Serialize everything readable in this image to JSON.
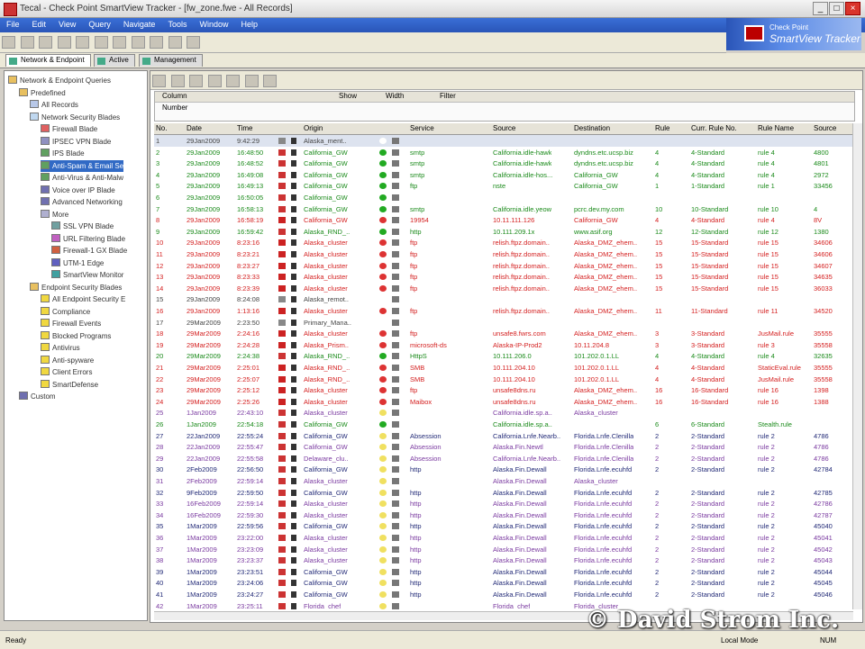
{
  "window": {
    "title": "Tecal - Check Point SmartView Tracker - [fw_zone.fwe - All Records]"
  },
  "menu": [
    "File",
    "Edit",
    "View",
    "Query",
    "Navigate",
    "Tools",
    "Window",
    "Help"
  ],
  "brand": {
    "line1": "Check Point",
    "line2": "SmartView Tracker"
  },
  "tabs": [
    {
      "label": "Network & Endpoint"
    },
    {
      "label": "Active"
    },
    {
      "label": "Management"
    }
  ],
  "tree": [
    {
      "label": "Network & Endpoint Queries",
      "level": 0
    },
    {
      "label": "Predefined",
      "level": 1
    },
    {
      "label": "All Records",
      "level": 2
    },
    {
      "label": "Network Security Blades",
      "level": 2
    },
    {
      "label": "Firewall Blade",
      "level": 3
    },
    {
      "label": "IPSEC VPN Blade",
      "level": 3
    },
    {
      "label": "IPS Blade",
      "level": 3
    },
    {
      "label": "Anti-Spam & Email Se",
      "level": 3,
      "selected": true
    },
    {
      "label": "Anti-Virus & Anti-Malw",
      "level": 3
    },
    {
      "label": "Voice over IP Blade",
      "level": 3
    },
    {
      "label": "Advanced Networking",
      "level": 3
    },
    {
      "label": "More",
      "level": 3
    },
    {
      "label": "SSL VPN Blade",
      "level": 4
    },
    {
      "label": "URL Filtering Blade",
      "level": 4
    },
    {
      "label": "Firewall-1 GX Blade",
      "level": 4
    },
    {
      "label": "UTM-1 Edge",
      "level": 4
    },
    {
      "label": "SmartView Monitor",
      "level": 4
    },
    {
      "label": "Endpoint Security Blades",
      "level": 2
    },
    {
      "label": "All Endpoint Security E",
      "level": 3
    },
    {
      "label": "Compliance",
      "level": 3
    },
    {
      "label": "Firewall Events",
      "level": 3
    },
    {
      "label": "Blocked Programs",
      "level": 3
    },
    {
      "label": "Antivirus",
      "level": 3
    },
    {
      "label": "Anti-spyware",
      "level": 3
    },
    {
      "label": "Client Errors",
      "level": 3
    },
    {
      "label": "SmartDefense",
      "level": 3
    },
    {
      "label": "Custom",
      "level": 1
    }
  ],
  "filter": {
    "col1": "Column",
    "col2": "Show",
    "col3": "Width",
    "col4": "Filter",
    "row1": "Number"
  },
  "columns": [
    "No.",
    "Date",
    "Time",
    "",
    "",
    "",
    "Origin",
    "",
    "",
    "",
    "",
    "Service",
    "Source",
    "Destination",
    "Rule",
    "Curr. Rule No.",
    "Rule Name",
    "Source"
  ],
  "rows": [
    {
      "no": "1",
      "date": "29Jan2009",
      "time": "9:42:29",
      "origin": "Alaska_ment..",
      "service": "",
      "src": "",
      "dst": "",
      "rule": "",
      "curr": "",
      "rname": "",
      "srcp": "",
      "c": "gray"
    },
    {
      "no": "2",
      "date": "29Jan2009",
      "time": "16:48:50",
      "origin": "California_GW",
      "service": "smtp",
      "src": "California.idle-hawk",
      "dst": "dyndns.etc.ucsp.biz",
      "rule": "4",
      "curr": "4-Standard",
      "rname": "rule 4",
      "srcp": "4800",
      "c": "green"
    },
    {
      "no": "3",
      "date": "29Jan2009",
      "time": "16:48:52",
      "origin": "California_GW",
      "service": "smtp",
      "src": "California.idle-hawk",
      "dst": "dyndns.etc.ucsp.biz",
      "rule": "4",
      "curr": "4-Standard",
      "rname": "rule 4",
      "srcp": "4801",
      "c": "green"
    },
    {
      "no": "4",
      "date": "29Jan2009",
      "time": "16:49:08",
      "origin": "California_GW",
      "service": "smtp",
      "src": "California.idle-hos...",
      "dst": "California_GW",
      "rule": "4",
      "curr": "4-Standard",
      "rname": "rule 4",
      "srcp": "2972",
      "c": "green"
    },
    {
      "no": "5",
      "date": "29Jan2009",
      "time": "16:49:13",
      "origin": "California_GW",
      "service": "ftp",
      "src": "nste",
      "dst": "California_GW",
      "rule": "1",
      "curr": "1-Standard",
      "rname": "rule 1",
      "srcp": "33456",
      "c": "green"
    },
    {
      "no": "6",
      "date": "29Jan2009",
      "time": "16:50:05",
      "origin": "California_GW",
      "service": "",
      "src": "",
      "dst": "",
      "rule": "",
      "curr": "",
      "rname": "",
      "srcp": "",
      "c": "green"
    },
    {
      "no": "7",
      "date": "29Jan2009",
      "time": "16:58:13",
      "origin": "California_GW",
      "service": "smtp",
      "src": "California.idle.yeow",
      "dst": "pcrc.dev.my.com",
      "rule": "10",
      "curr": "10-Standard",
      "rname": "rule 10",
      "srcp": "4",
      "c": "green"
    },
    {
      "no": "8",
      "date": "29Jan2009",
      "time": "16:58:19",
      "origin": "California_GW",
      "service": "19954",
      "src": "10.11.111.126",
      "dst": "California_GW",
      "rule": "4",
      "curr": "4-Standard",
      "rname": "rule 4",
      "srcp": "8V",
      "c": "red"
    },
    {
      "no": "9",
      "date": "29Jan2009",
      "time": "16:59:42",
      "origin": "Alaska_RND_..",
      "service": "http",
      "src": "10.111.209.1x",
      "dst": "www.asif.org",
      "rule": "12",
      "curr": "12-Standard",
      "rname": "rule 12",
      "srcp": "1380",
      "c": "green"
    },
    {
      "no": "10",
      "date": "29Jan2009",
      "time": "8:23:16",
      "origin": "Alaska_cluster",
      "service": "ftp",
      "src": "relish.ftpz.domain..",
      "dst": "Alaska_DMZ_ehem..",
      "rule": "15",
      "curr": "15-Standard",
      "rname": "rule 15",
      "srcp": "34606",
      "c": "red"
    },
    {
      "no": "11",
      "date": "29Jan2009",
      "time": "8:23:21",
      "origin": "Alaska_cluster",
      "service": "ftp",
      "src": "relish.ftpz.domain..",
      "dst": "Alaska_DMZ_ehem..",
      "rule": "15",
      "curr": "15-Standard",
      "rname": "rule 15",
      "srcp": "34606",
      "c": "red"
    },
    {
      "no": "12",
      "date": "29Jan2009",
      "time": "8:23:27",
      "origin": "Alaska_cluster",
      "service": "ftp",
      "src": "relish.ftpz.domain..",
      "dst": "Alaska_DMZ_ehem..",
      "rule": "15",
      "curr": "15-Standard",
      "rname": "rule 15",
      "srcp": "34607",
      "c": "red"
    },
    {
      "no": "13",
      "date": "29Jan2009",
      "time": "8:23:33",
      "origin": "Alaska_cluster",
      "service": "ftp",
      "src": "relish.ftpz.domain..",
      "dst": "Alaska_DMZ_ehem..",
      "rule": "15",
      "curr": "15-Standard",
      "rname": "rule 15",
      "srcp": "34635",
      "c": "red"
    },
    {
      "no": "14",
      "date": "29Jan2009",
      "time": "8:23:39",
      "origin": "Alaska_cluster",
      "service": "ftp",
      "src": "relish.ftpz.domain..",
      "dst": "Alaska_DMZ_ehem..",
      "rule": "15",
      "curr": "15-Standard",
      "rname": "rule 15",
      "srcp": "36033",
      "c": "red"
    },
    {
      "no": "15",
      "date": "29Jan2009",
      "time": "8:24:08",
      "origin": "Alaska_remot..",
      "service": "",
      "src": "",
      "dst": "",
      "rule": "",
      "curr": "",
      "rname": "",
      "srcp": "",
      "c": "gray"
    },
    {
      "no": "16",
      "date": "29Jan2009",
      "time": "1:13:16",
      "origin": "Alaska_cluster",
      "service": "ftp",
      "src": "relish.ftpz.domain..",
      "dst": "Alaska_DMZ_ehem..",
      "rule": "11",
      "curr": "11-Standard",
      "rname": "rule 11",
      "srcp": "34520",
      "c": "red"
    },
    {
      "no": "17",
      "date": "29Mar2009",
      "time": "2:23:50",
      "origin": "Primary_Mana..",
      "service": "",
      "src": "",
      "dst": "",
      "rule": "",
      "curr": "",
      "rname": "",
      "srcp": "",
      "c": "gray"
    },
    {
      "no": "18",
      "date": "29Mar2009",
      "time": "2:24:16",
      "origin": "Alaska_cluster",
      "service": "ftp",
      "src": "unsafe8.fwrs.com",
      "dst": "Alaska_DMZ_ehem..",
      "rule": "3",
      "curr": "3-Standard",
      "rname": "JusMail.rule",
      "srcp": "35555",
      "c": "red"
    },
    {
      "no": "19",
      "date": "29Mar2009",
      "time": "2:24:28",
      "origin": "Alaska_Prism..",
      "service": "microsoft-ds",
      "src": "Alaska-IP-Prod2",
      "dst": "10.11.204.8",
      "rule": "3",
      "curr": "3-Standard",
      "rname": "rule 3",
      "srcp": "35558",
      "c": "red"
    },
    {
      "no": "20",
      "date": "29Mar2009",
      "time": "2:24:38",
      "origin": "Alaska_RND_..",
      "service": "HttpS",
      "src": "10.111.206.0",
      "dst": "101.202.0.1.LL",
      "rule": "4",
      "curr": "4-Standard",
      "rname": "rule 4",
      "srcp": "32635",
      "c": "green"
    },
    {
      "no": "21",
      "date": "29Mar2009",
      "time": "2:25:01",
      "origin": "Alaska_RND_..",
      "service": "SMB",
      "src": "10.111.204.10",
      "dst": "101.202.0.1.LL",
      "rule": "4",
      "curr": "4-Standard",
      "rname": "StaticEval.rule",
      "srcp": "35555",
      "c": "red"
    },
    {
      "no": "22",
      "date": "29Mar2009",
      "time": "2:25:07",
      "origin": "Alaska_RND_..",
      "service": "SMB",
      "src": "10.111.204.10",
      "dst": "101.202.0.1.LL",
      "rule": "4",
      "curr": "4-Standard",
      "rname": "JusMail.rule",
      "srcp": "35558",
      "c": "red"
    },
    {
      "no": "23",
      "date": "29Mar2009",
      "time": "2:25:12",
      "origin": "Alaska_cluster",
      "service": "ftp",
      "src": "unsafe8dns.ru",
      "dst": "Alaska_DMZ_ehem..",
      "rule": "16",
      "curr": "16-Standard",
      "rname": "rule 16",
      "srcp": "1398",
      "c": "red"
    },
    {
      "no": "24",
      "date": "29Mar2009",
      "time": "2:25:26",
      "origin": "Alaska_cluster",
      "service": "Maibox",
      "src": "unsafe8dns.ru",
      "dst": "Alaska_DMZ_ehem..",
      "rule": "16",
      "curr": "16-Standard",
      "rname": "rule 16",
      "srcp": "1388",
      "c": "red"
    },
    {
      "no": "25",
      "date": "1Jan2009",
      "time": "22:43:10",
      "origin": "Alaska_cluster",
      "service": "",
      "src": "California.idle.sp.a..",
      "dst": "Alaska_cluster",
      "rule": "",
      "curr": "",
      "rname": "",
      "srcp": "",
      "c": "purple"
    },
    {
      "no": "26",
      "date": "1Jan2009",
      "time": "22:54:18",
      "origin": "California_GW",
      "service": "",
      "src": "California.idle.sp.a..",
      "dst": "",
      "rule": "6",
      "curr": "6-Standard",
      "rname": "Stealth.rule",
      "srcp": "",
      "c": "green"
    },
    {
      "no": "27",
      "date": "22Jan2009",
      "time": "22:55:24",
      "origin": "California_GW",
      "service": "Absession",
      "src": "California.Lnfe.Nearb..",
      "dst": "Florida.Lnfe.Clenilla",
      "rule": "2",
      "curr": "2-Standard",
      "rname": "rule 2",
      "srcp": "4786",
      "c": "navy"
    },
    {
      "no": "28",
      "date": "22Jan2009",
      "time": "22:55:47",
      "origin": "California_GW",
      "service": "Absession",
      "src": "Alaska.Fin.Newtl",
      "dst": "Florida.Lnfe.Clenilla",
      "rule": "2",
      "curr": "2-Standard",
      "rname": "rule 2",
      "srcp": "4786",
      "c": "purple"
    },
    {
      "no": "29",
      "date": "22Jan2009",
      "time": "22:55:58",
      "origin": "Delaware_clu..",
      "service": "Absession",
      "src": "California.Lnfe.Nearb..",
      "dst": "Florida.Lnfe.Clenilla",
      "rule": "2",
      "curr": "2-Standard",
      "rname": "rule 2",
      "srcp": "4786",
      "c": "purple"
    },
    {
      "no": "30",
      "date": "2Feb2009",
      "time": "22:56:50",
      "origin": "California_GW",
      "service": "http",
      "src": "Alaska.Fin.Dewall",
      "dst": "Florida.Lnfe.ecuhfd",
      "rule": "2",
      "curr": "2-Standard",
      "rname": "rule 2",
      "srcp": "42784",
      "c": "navy"
    },
    {
      "no": "31",
      "date": "2Feb2009",
      "time": "22:59:14",
      "origin": "Alaska_cluster",
      "service": "",
      "src": "Alaska.Fin.Dewall",
      "dst": "Alaska_cluster",
      "rule": "",
      "curr": "",
      "rname": "",
      "srcp": "",
      "c": "purple"
    },
    {
      "no": "32",
      "date": "9Feb2009",
      "time": "22:59:50",
      "origin": "California_GW",
      "service": "http",
      "src": "Alaska.Fin.Dewall",
      "dst": "Florida.Lnfe.ecuhfd",
      "rule": "2",
      "curr": "2-Standard",
      "rname": "rule 2",
      "srcp": "42785",
      "c": "navy"
    },
    {
      "no": "33",
      "date": "16Feb2009",
      "time": "22:59:14",
      "origin": "Alaska_cluster",
      "service": "http",
      "src": "Alaska.Fin.Dewall",
      "dst": "Florida.Lnfe.ecuhfd",
      "rule": "2",
      "curr": "2-Standard",
      "rname": "rule 2",
      "srcp": "42786",
      "c": "purple"
    },
    {
      "no": "34",
      "date": "16Feb2009",
      "time": "22:59:30",
      "origin": "Alaska_cluster",
      "service": "http",
      "src": "Alaska.Fin.Dewall",
      "dst": "Florida.Lnfe.ecuhfd",
      "rule": "2",
      "curr": "2-Standard",
      "rname": "rule 2",
      "srcp": "42787",
      "c": "purple"
    },
    {
      "no": "35",
      "date": "1Mar2009",
      "time": "22:59:56",
      "origin": "California_GW",
      "service": "http",
      "src": "Alaska.Fin.Dewall",
      "dst": "Florida.Lnfe.ecuhfd",
      "rule": "2",
      "curr": "2-Standard",
      "rname": "rule 2",
      "srcp": "45040",
      "c": "navy"
    },
    {
      "no": "36",
      "date": "1Mar2009",
      "time": "23:22:00",
      "origin": "Alaska_cluster",
      "service": "http",
      "src": "Alaska.Fin.Dewall",
      "dst": "Florida.Lnfe.ecuhfd",
      "rule": "2",
      "curr": "2-Standard",
      "rname": "rule 2",
      "srcp": "45041",
      "c": "purple"
    },
    {
      "no": "37",
      "date": "1Mar2009",
      "time": "23:23:09",
      "origin": "Alaska_cluster",
      "service": "http",
      "src": "Alaska.Fin.Dewall",
      "dst": "Florida.Lnfe.ecuhfd",
      "rule": "2",
      "curr": "2-Standard",
      "rname": "rule 2",
      "srcp": "45042",
      "c": "purple"
    },
    {
      "no": "38",
      "date": "1Mar2009",
      "time": "23:23:37",
      "origin": "Alaska_cluster",
      "service": "http",
      "src": "Alaska.Fin.Dewall",
      "dst": "Florida.Lnfe.ecuhfd",
      "rule": "2",
      "curr": "2-Standard",
      "rname": "rule 2",
      "srcp": "45043",
      "c": "purple"
    },
    {
      "no": "39",
      "date": "1Mar2009",
      "time": "23:23:51",
      "origin": "California_GW",
      "service": "http",
      "src": "Alaska.Fin.Dewall",
      "dst": "Florida.Lnfe.ecuhfd",
      "rule": "2",
      "curr": "2-Standard",
      "rname": "rule 2",
      "srcp": "45044",
      "c": "navy"
    },
    {
      "no": "40",
      "date": "1Mar2009",
      "time": "23:24:06",
      "origin": "California_GW",
      "service": "http",
      "src": "Alaska.Fin.Dewall",
      "dst": "Florida.Lnfe.ecuhfd",
      "rule": "2",
      "curr": "2-Standard",
      "rname": "rule 2",
      "srcp": "45045",
      "c": "navy"
    },
    {
      "no": "41",
      "date": "1Mar2009",
      "time": "23:24:27",
      "origin": "California_GW",
      "service": "http",
      "src": "Alaska.Fin.Dewall",
      "dst": "Florida.Lnfe.ecuhfd",
      "rule": "2",
      "curr": "2-Standard",
      "rname": "rule 2",
      "srcp": "45046",
      "c": "navy"
    },
    {
      "no": "42",
      "date": "1Mar2009",
      "time": "23:25:11",
      "origin": "Florida_chef",
      "service": "",
      "src": "Florida_chef",
      "dst": "Florida_cluster",
      "rule": "",
      "curr": "",
      "rname": "",
      "srcp": "",
      "c": "purple"
    }
  ],
  "status": {
    "left": "Ready",
    "right1": "Local Mode",
    "right2": "NUM"
  },
  "watermark": "© David Strom Inc."
}
